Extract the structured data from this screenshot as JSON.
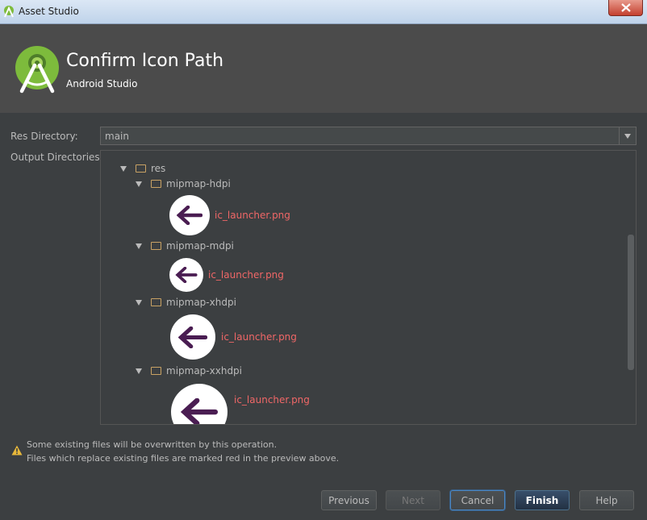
{
  "window": {
    "title": "Asset Studio"
  },
  "header": {
    "title": "Confirm Icon Path",
    "subtitle": "Android Studio",
    "logo_icon": "android-studio-logo-icon"
  },
  "form": {
    "res_directory_label": "Res Directory:",
    "res_directory_value": "main",
    "output_directories_label": "Output Directories:"
  },
  "tree": {
    "root": "res",
    "folders": [
      {
        "name": "mipmap-hdpi",
        "file": "ic_launcher.png"
      },
      {
        "name": "mipmap-mdpi",
        "file": "ic_launcher.png"
      },
      {
        "name": "mipmap-xhdpi",
        "file": "ic_launcher.png"
      },
      {
        "name": "mipmap-xxhdpi",
        "file": "ic_launcher.png"
      }
    ]
  },
  "warning": {
    "line1": "Some existing files will be overwritten by this operation.",
    "line2": "Files which replace existing files are marked red in the preview above."
  },
  "buttons": {
    "previous": "Previous",
    "next": "Next",
    "cancel": "Cancel",
    "finish": "Finish",
    "help": "Help"
  },
  "colors": {
    "accent": "#4a88c7",
    "overwrite": "#f06767",
    "folder": "#c9a264",
    "icon_arrow": "#4a1d52"
  }
}
